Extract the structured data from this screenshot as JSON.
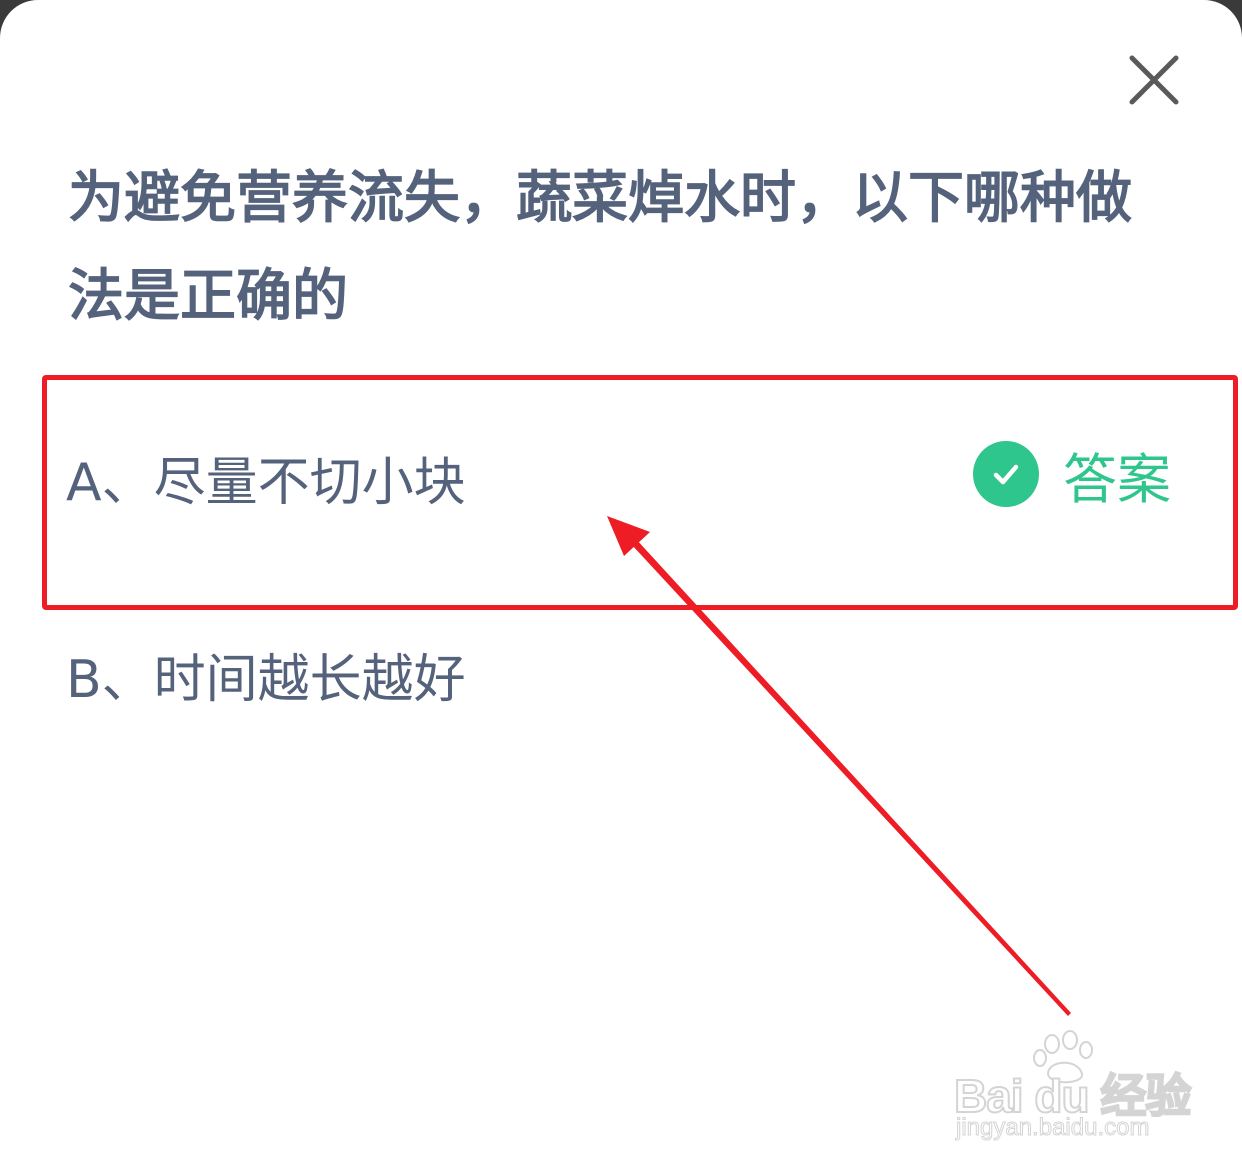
{
  "question": {
    "text": "为避免营养流失，蔬菜焯水时，以下哪种做法是正确的"
  },
  "options": [
    {
      "label": "A、尽量不切小块",
      "is_answer": true
    },
    {
      "label": "B、时间越长越好",
      "is_answer": false
    }
  ],
  "answer_tag": {
    "label": "答案",
    "icon": "check-circle-icon",
    "color": "#2fc68d"
  },
  "close_button": {
    "icon": "close-icon"
  },
  "annotation": {
    "highlight_color": "#ee1c24",
    "arrow_color": "#ee1c24"
  },
  "watermark": {
    "brand": "Bai  du 经验",
    "url": "jingyan.baidu.com",
    "icon": "paw-icon"
  },
  "colors": {
    "question_text": "#55627c",
    "option_text": "#55627c",
    "background": "#ffffff"
  }
}
